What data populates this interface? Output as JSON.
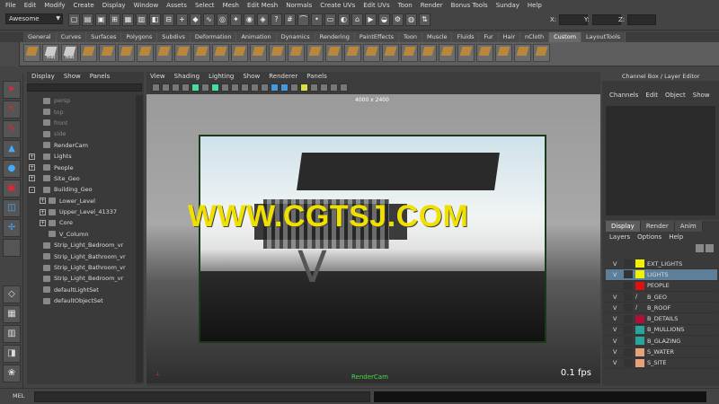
{
  "menubar": [
    "File",
    "Edit",
    "Modify",
    "Create",
    "Display",
    "Window",
    "Assets",
    "Select",
    "Mesh",
    "Edit Mesh",
    "Normals",
    "Create UVs",
    "Edit UVs",
    "Toon",
    "Render",
    "Bonus Tools",
    "Sunday",
    "Help"
  ],
  "status": {
    "mode": "Awesome",
    "x_label": "X:",
    "y_label": "Y:",
    "z_label": "Z:"
  },
  "shelf_tabs": [
    "General",
    "Curves",
    "Surfaces",
    "Polygons",
    "Subdivs",
    "Deformation",
    "Animation",
    "Dynamics",
    "Rendering",
    "PaintEffects",
    "Toon",
    "Muscle",
    "Fluids",
    "Fur",
    "Hair",
    "nCloth",
    "Custom",
    "LayoutTools"
  ],
  "shelf_active": "Custom",
  "shelf_hist_label": "Hist",
  "outliner": {
    "menu": [
      "Display",
      "Show",
      "Panels"
    ],
    "items": [
      {
        "label": "persp",
        "dim": true,
        "indent": 0,
        "exp": ""
      },
      {
        "label": "top",
        "dim": true,
        "indent": 0,
        "exp": ""
      },
      {
        "label": "front",
        "dim": true,
        "indent": 0,
        "exp": ""
      },
      {
        "label": "side",
        "dim": true,
        "indent": 0,
        "exp": ""
      },
      {
        "label": "RenderCam",
        "dim": false,
        "indent": 0,
        "exp": ""
      },
      {
        "label": "Lights",
        "dim": false,
        "indent": 0,
        "exp": "+"
      },
      {
        "label": "People",
        "dim": false,
        "indent": 0,
        "exp": "+"
      },
      {
        "label": "Site_Geo",
        "dim": false,
        "indent": 0,
        "exp": "+"
      },
      {
        "label": "Building_Geo",
        "dim": false,
        "indent": 0,
        "exp": "-"
      },
      {
        "label": "Lower_Level",
        "dim": false,
        "indent": 1,
        "exp": "+"
      },
      {
        "label": "Upper_Level_41337",
        "dim": false,
        "indent": 1,
        "exp": "+"
      },
      {
        "label": "Core",
        "dim": false,
        "indent": 1,
        "exp": "+"
      },
      {
        "label": "V_Column",
        "dim": false,
        "indent": 1,
        "exp": ""
      },
      {
        "label": "Strip_Light_Bedroom_vr",
        "dim": false,
        "indent": 0,
        "exp": ""
      },
      {
        "label": "Strip_Light_Bathroom_vr",
        "dim": false,
        "indent": 0,
        "exp": ""
      },
      {
        "label": "Strip_Light_Bathroom_vr",
        "dim": false,
        "indent": 0,
        "exp": ""
      },
      {
        "label": "Strip_Light_Bedroom_vr",
        "dim": false,
        "indent": 0,
        "exp": ""
      },
      {
        "label": "defaultLightSet",
        "dim": false,
        "indent": 0,
        "exp": ""
      },
      {
        "label": "defaultObjectSet",
        "dim": false,
        "indent": 0,
        "exp": ""
      }
    ]
  },
  "viewport": {
    "menu": [
      "View",
      "Shading",
      "Lighting",
      "Show",
      "Renderer",
      "Panels"
    ],
    "resolution": "4000 x 2400",
    "camera": "RenderCam",
    "fps": "0.1 fps",
    "watermark": "WWW.CGTSJ.COM",
    "letter": "V"
  },
  "channel_box": {
    "title": "Channel Box / Layer Editor",
    "menu": [
      "Channels",
      "Edit",
      "Object",
      "Show"
    ]
  },
  "layer_editor": {
    "tabs": [
      "Display",
      "Render",
      "Anim"
    ],
    "active_tab": "Display",
    "menu": [
      "Layers",
      "Options",
      "Help"
    ],
    "layers": [
      {
        "vis": "V",
        "name": "EXT_LIGHTS",
        "color": "#f2f200",
        "selected": false
      },
      {
        "vis": "V",
        "name": "LIGHTS",
        "color": "#f2f200",
        "selected": true
      },
      {
        "vis": "",
        "name": "PEOPLE",
        "color": "#e01010",
        "selected": false
      },
      {
        "vis": "V",
        "name": "B_GEO",
        "color": "",
        "selected": false
      },
      {
        "vis": "V",
        "name": "B_ROOF",
        "color": "",
        "selected": false
      },
      {
        "vis": "V",
        "name": "B_DETAILS",
        "color": "#b0103a",
        "selected": false
      },
      {
        "vis": "V",
        "name": "B_MULLIONS",
        "color": "#28a59a",
        "selected": false
      },
      {
        "vis": "V",
        "name": "B_GLAZING",
        "color": "#28a59a",
        "selected": false
      },
      {
        "vis": "V",
        "name": "S_WATER",
        "color": "#e7a27a",
        "selected": false
      },
      {
        "vis": "V",
        "name": "S_SITE",
        "color": "#e7a27a",
        "selected": false
      }
    ]
  },
  "command_line": {
    "label": "MEL"
  }
}
